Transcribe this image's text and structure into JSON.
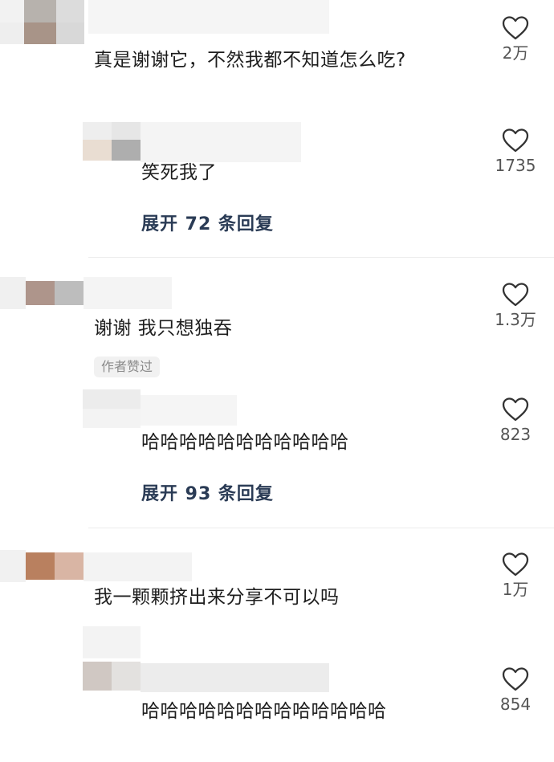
{
  "comments": [
    {
      "text": "真是谢谢它，不然我都不知道怎么吃?",
      "likes": "2万"
    },
    {
      "text": "笑死我了",
      "likes": "1735",
      "expand_label": "展开 72 条回复"
    },
    {
      "text": "谢谢 我只想独吞",
      "likes": "1.3万",
      "badge": "作者赞过"
    },
    {
      "text": "哈哈哈哈哈哈哈哈哈哈哈",
      "likes": "823",
      "expand_label": "展开 93 条回复"
    },
    {
      "text": "我一颗颗挤出来分享不可以吗",
      "likes": "1万"
    },
    {
      "text": "哈哈哈哈哈哈哈哈哈哈哈哈哈",
      "likes": "854"
    }
  ],
  "icons": {
    "like": "heart-outline-icon"
  },
  "colors": {
    "expand": "#2a3b55",
    "count": "#555555",
    "text": "#1e1e1e"
  }
}
